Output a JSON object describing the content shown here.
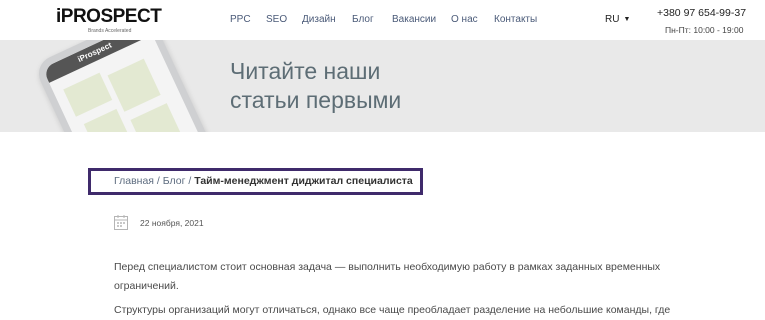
{
  "header": {
    "logo_text": "iPROSPECT",
    "logo_tagline": "Brands Accelerated",
    "nav": [
      {
        "label": "PPC"
      },
      {
        "label": "SEO"
      },
      {
        "label": "Дизайн"
      },
      {
        "label": "Блог"
      },
      {
        "label": "Вакансии"
      },
      {
        "label": "О нас"
      },
      {
        "label": "Контакты"
      }
    ],
    "language": "RU",
    "phone": "+380 97 654-99-37",
    "hours": "Пн-Пт: 10:00 - 19:00"
  },
  "banner": {
    "title": "Читайте наши\nстатьи первыми",
    "device_logo": "iProspect"
  },
  "breadcrumb": {
    "items": [
      {
        "label": "Главная"
      },
      {
        "label": "Блог"
      }
    ],
    "separator": "/",
    "current": "Тайм-менеджмент диджитал специалиста"
  },
  "article": {
    "date": "22 ноября, 2021",
    "paragraphs": [
      "Перед специалистом стоит основная задача — выполнить необходимую работу в рамках заданных временных ограничений.",
      "Структуры организаций могут отличаться, однако все чаще преобладает разделение на небольшие команды, где"
    ]
  },
  "colors": {
    "banner_bg": "#e9e9e9",
    "nav_text": "#4a5a78",
    "highlight_border": "#3f2a6b",
    "banner_title": "#5d6d75"
  }
}
